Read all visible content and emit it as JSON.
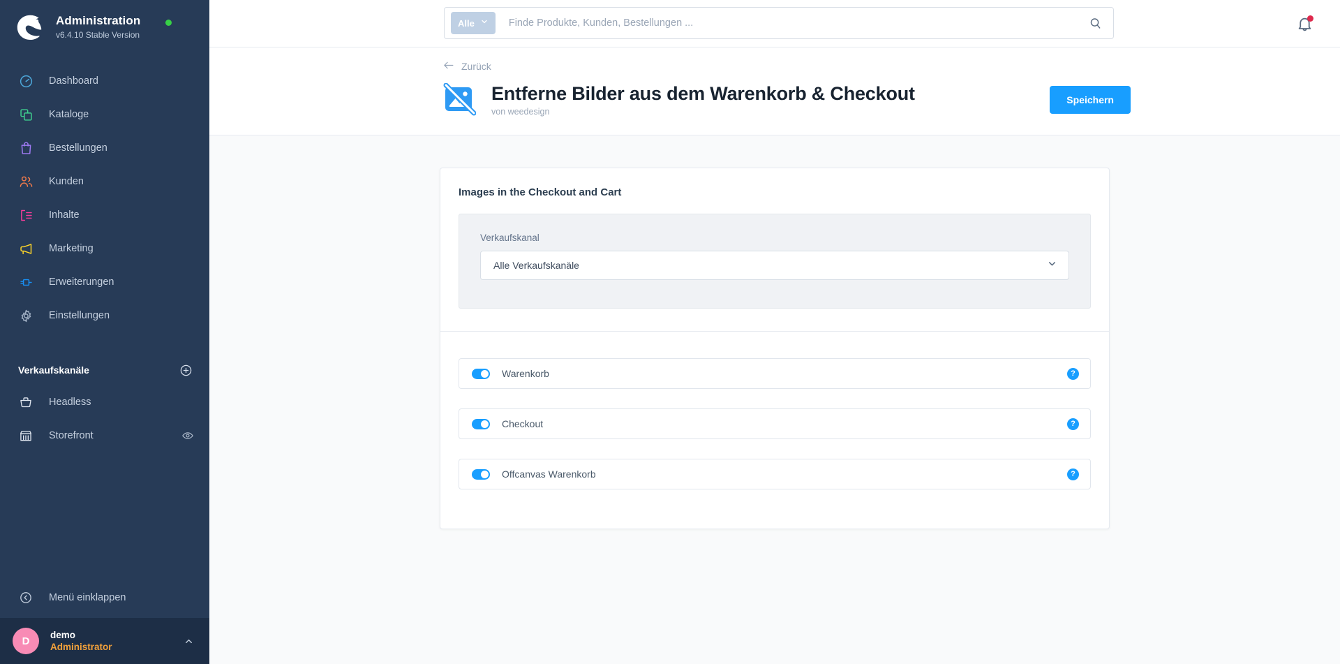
{
  "sidebar": {
    "brand": {
      "title": "Administration",
      "version": "v6.4.10 Stable Version",
      "logo_icon": "shopware-logo-icon",
      "status_dot_color": "#37D046"
    },
    "nav_items": [
      {
        "label": "Dashboard",
        "icon": "dashboard-gauge-icon",
        "color": "#4DA8DA"
      },
      {
        "label": "Kataloge",
        "icon": "catalog-copy-icon",
        "color": "#3ECF8E"
      },
      {
        "label": "Bestellungen",
        "icon": "orders-bag-icon",
        "color": "#A07BF5"
      },
      {
        "label": "Kunden",
        "icon": "customers-people-icon",
        "color": "#F07A4B"
      },
      {
        "label": "Inhalte",
        "icon": "content-layout-icon",
        "color": "#F53D9A"
      },
      {
        "label": "Marketing",
        "icon": "marketing-megaphone-icon",
        "color": "#FFD629"
      },
      {
        "label": "Erweiterungen",
        "icon": "extensions-plug-icon",
        "color": "#1890F5"
      },
      {
        "label": "Einstellungen",
        "icon": "settings-gear-icon",
        "color": "#9FAEC2"
      }
    ],
    "section": {
      "title": "Verkaufskanäle",
      "add_icon": "plus-circle-icon"
    },
    "channels": [
      {
        "label": "Headless",
        "icon": "basket-icon",
        "eye": false
      },
      {
        "label": "Storefront",
        "icon": "storefront-icon",
        "eye": true
      }
    ],
    "collapse": {
      "label": "Menü einklappen",
      "icon": "collapse-left-icon"
    },
    "user": {
      "initial": "D",
      "name": "demo",
      "role": "Administrator",
      "caret_icon": "chevron-up-icon",
      "avatar_color": "#F88BB5",
      "role_color": "#F2A13B"
    }
  },
  "topbar": {
    "search": {
      "scope_label": "Alle",
      "scope_caret_icon": "chevron-down-icon",
      "placeholder": "Finde Produkte, Kunden, Bestellungen ...",
      "value": "",
      "submit_icon": "search-icon"
    },
    "notifications": {
      "icon": "bell-icon",
      "has_unread": true,
      "badge_color": "#DE294C"
    }
  },
  "page_header": {
    "back_label": "Zurück",
    "back_icon": "arrow-left-icon",
    "plugin_icon": "image-off-icon",
    "plugin_icon_color": "#2E9AF4",
    "title": "Entferne Bilder aus dem Warenkorb & Checkout",
    "subtitle": "von weedesign",
    "save_label": "Speichern",
    "accent_color": "#189EFF"
  },
  "card": {
    "title": "Images in the Checkout and Cart",
    "sales_channel_field": {
      "label": "Verkaufskanal",
      "value": "Alle Verkaufskanäle",
      "caret_icon": "chevron-down-icon"
    },
    "toggles": [
      {
        "label": "Warenkorb",
        "on": true,
        "help_icon": "question-mark-icon",
        "help_label": "?"
      },
      {
        "label": "Checkout",
        "on": true,
        "help_icon": "question-mark-icon",
        "help_label": "?"
      },
      {
        "label": "Offcanvas Warenkorb",
        "on": true,
        "help_icon": "question-mark-icon",
        "help_label": "?"
      }
    ]
  }
}
